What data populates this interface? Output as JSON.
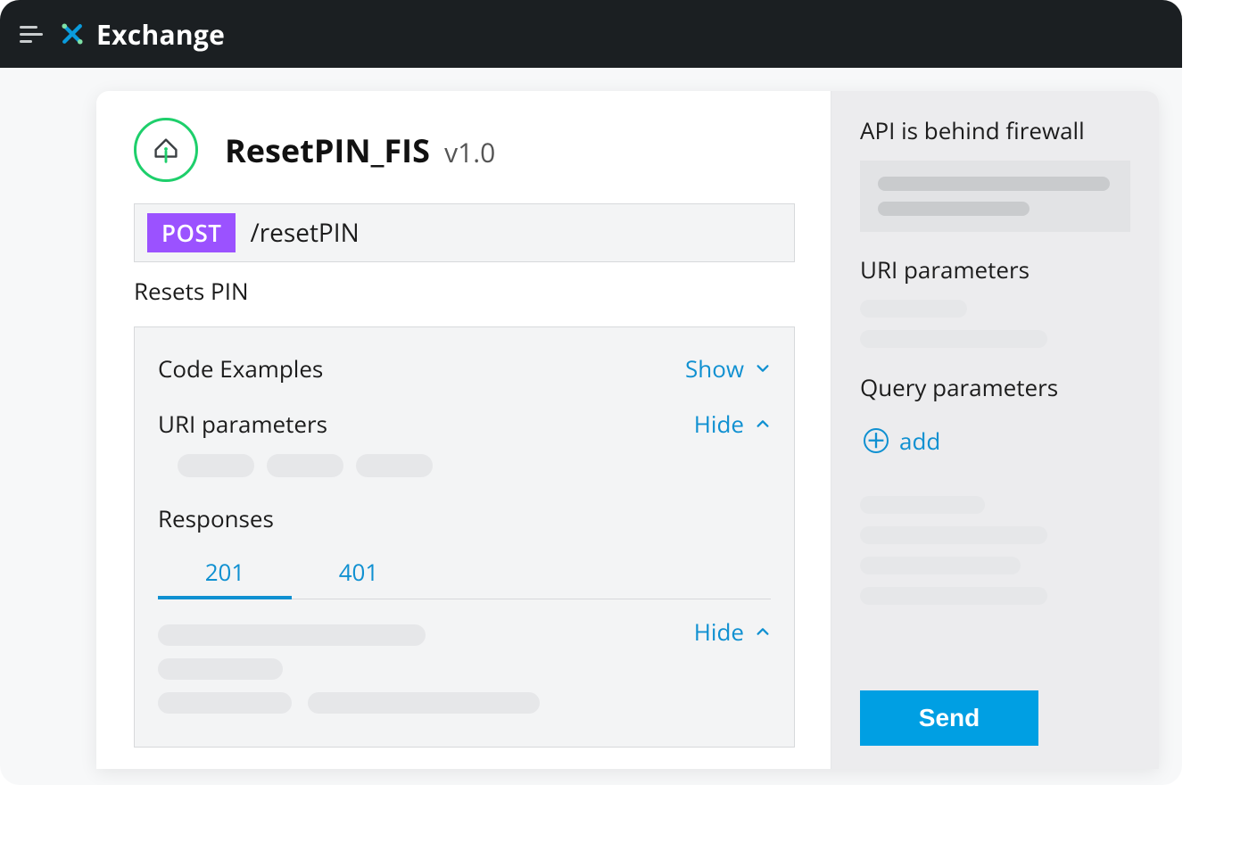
{
  "header": {
    "brand": "Exchange"
  },
  "api": {
    "name": "ResetPIN_FIS",
    "version": "v1.0",
    "method": "POST",
    "path": "/resetPIN",
    "description": "Resets PIN"
  },
  "panel": {
    "code_examples": {
      "label": "Code Examples",
      "toggle": "Show"
    },
    "uri_params": {
      "label": "URI parameters",
      "toggle": "Hide"
    },
    "responses": {
      "label": "Responses",
      "tabs": [
        "201",
        "401"
      ],
      "active": "201",
      "toggle": "Hide"
    }
  },
  "sidebar": {
    "firewall_label": "API is behind firewall",
    "uri_params_label": "URI parameters",
    "query_params_label": "Query parameters",
    "add_label": "add",
    "send_label": "Send"
  },
  "colors": {
    "accent_blue": "#0f90d1",
    "method_purple": "#9b52ff",
    "send_blue": "#009fe3",
    "brand_green": "#1ecf6b"
  }
}
